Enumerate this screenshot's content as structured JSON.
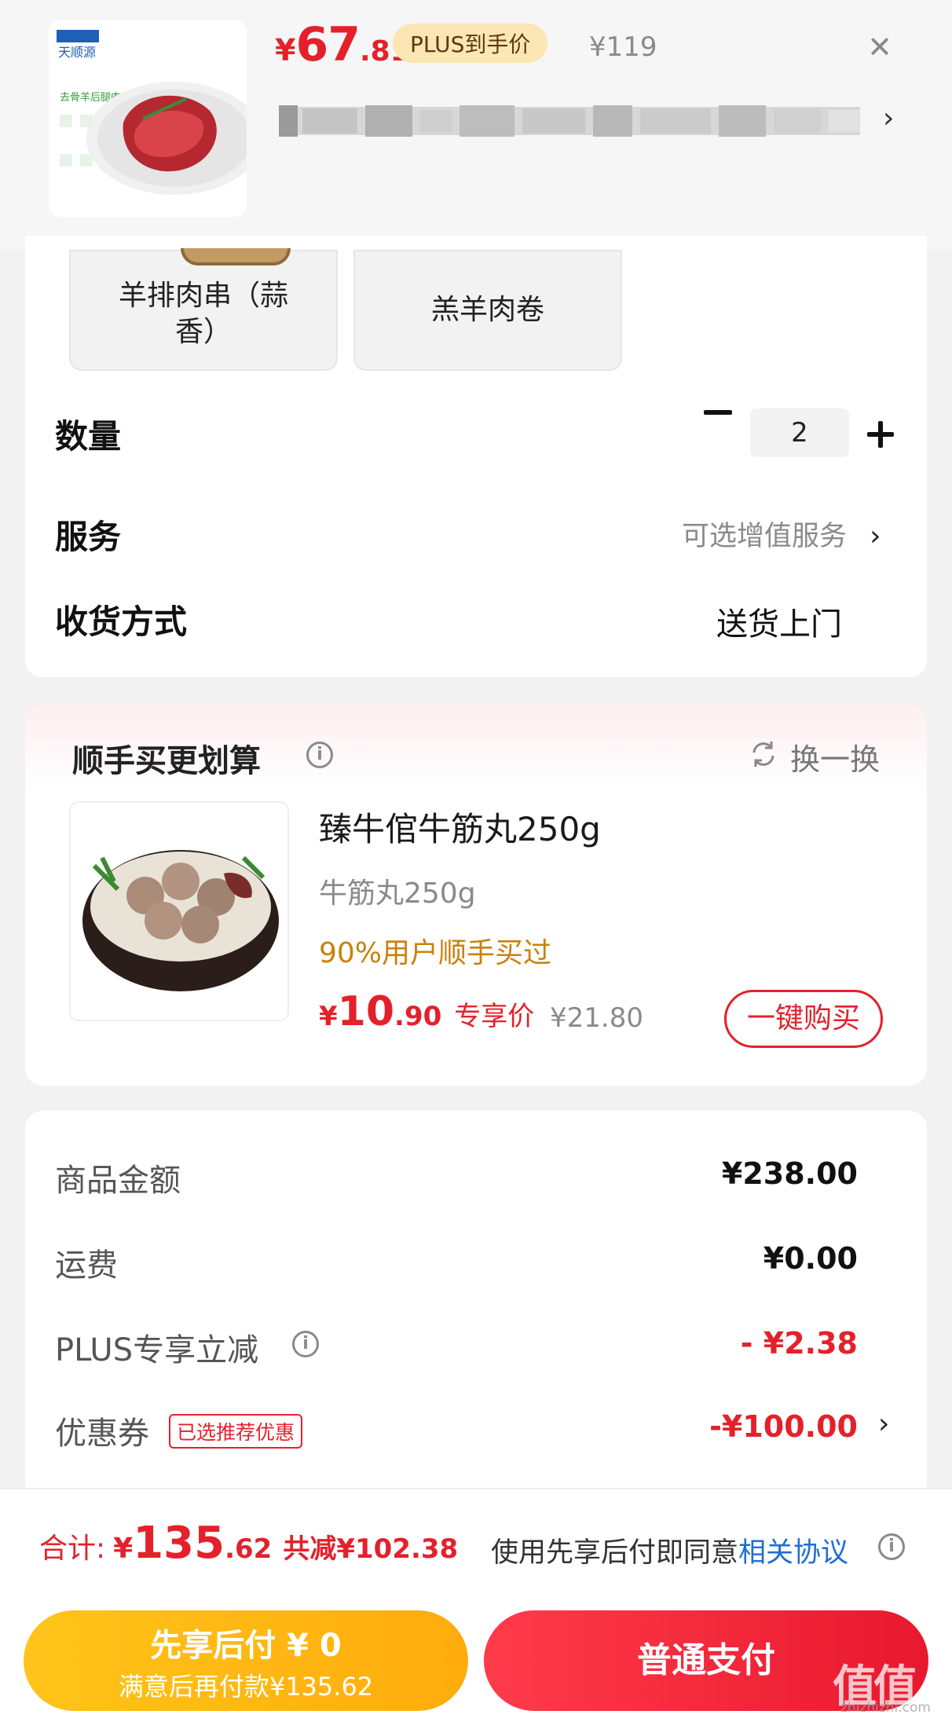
{
  "product": {
    "price_symbol": "¥",
    "price_int": "67",
    "price_dec": ".81",
    "plus_badge": "PLUS到手价",
    "original_price": "¥119",
    "close_icon": "close-icon",
    "image_label": "天顺源",
    "image_caption": "去骨羊后腿肉"
  },
  "variants": [
    {
      "label": "羊排肉串（蒜香）"
    },
    {
      "label": "羔羊肉卷"
    }
  ],
  "quantity": {
    "label": "数量",
    "value": "2"
  },
  "service": {
    "label": "服务",
    "value": "可选增值服务"
  },
  "shipping": {
    "label": "收货方式",
    "value": "送货上门"
  },
  "recommend": {
    "title": "顺手买更划算",
    "swap_label": "换一换",
    "item": {
      "name": "臻牛倌牛筋丸250g",
      "spec": "牛筋丸250g",
      "popularity": "90%用户顺手买过",
      "price_symbol": "¥",
      "price_int": "10",
      "price_dec": ".90",
      "price_tag": "专享价",
      "original_price": "¥21.80",
      "buy_label": "一键购买"
    }
  },
  "amounts": [
    {
      "label": "商品金额",
      "value": "¥238.00",
      "emphasis": "normal"
    },
    {
      "label": "运费",
      "value": "¥0.00",
      "emphasis": "normal"
    },
    {
      "label": "PLUS专享立减",
      "value": "- ¥2.38",
      "emphasis": "red"
    },
    {
      "label": "优惠券",
      "value": "-¥100.00",
      "emphasis": "red",
      "tag": "已选推荐优惠"
    }
  ],
  "total": {
    "label": "合计:",
    "symbol": "¥",
    "int": "135",
    "dec": ".62",
    "saved": "共减¥102.38"
  },
  "agreement": {
    "prefix": "使用先享后付即同意",
    "link": "相关协议"
  },
  "buttons": {
    "bnpl_main": "先享后付 ¥ 0",
    "bnpl_sub": "满意后再付款¥135.62",
    "pay": "普通支付"
  },
  "watermark": {
    "text": "值值值",
    "sub": "zhizhizhi.com"
  },
  "colors": {
    "accent_red": "#e4212b",
    "gold": "#ffc41a",
    "link_blue": "#1f6ed4"
  }
}
